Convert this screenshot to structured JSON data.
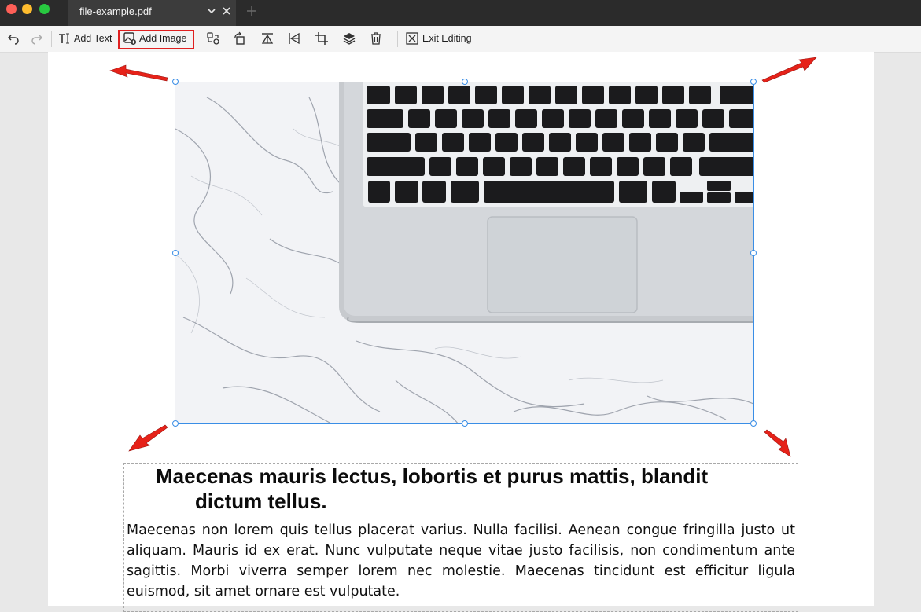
{
  "window": {
    "tab_title": "file-example.pdf",
    "traffic_lights": {
      "close": "#fe5f57",
      "minimize": "#febc2e",
      "zoom": "#28c840"
    }
  },
  "toolbar": {
    "undo_icon": "undo-icon",
    "redo_icon": "redo-icon",
    "add_text_label": "Add Text",
    "add_image_label": "Add Image",
    "add_image_highlighted": true,
    "highlight_color": "#e02020",
    "icons": [
      "replace-image-icon",
      "rotate-icon",
      "flip-vertical-icon",
      "flip-horizontal-icon",
      "crop-icon",
      "layers-icon",
      "trash-icon"
    ],
    "exit_editing_label": "Exit Editing"
  },
  "document": {
    "selected_image": "laptop-on-marble-image",
    "selection_color": "#3a8ee6",
    "annotation_color": "#e62219",
    "heading": {
      "line1": "Maecenas mauris lectus, lobortis et purus mattis, blandit",
      "line2": "dictum tellus."
    },
    "paragraph": "Maecenas non lorem quis tellus placerat varius. Nulla facilisi. Aenean congue fringilla justo ut aliquam. Mauris id ex erat. Nunc vulputate neque vitae justo facilisis, non condimentum ante sagittis. Morbi viverra semper lorem nec molestie. Maecenas tincidunt est efficitur ligula euismod, sit amet ornare est vulputate."
  }
}
